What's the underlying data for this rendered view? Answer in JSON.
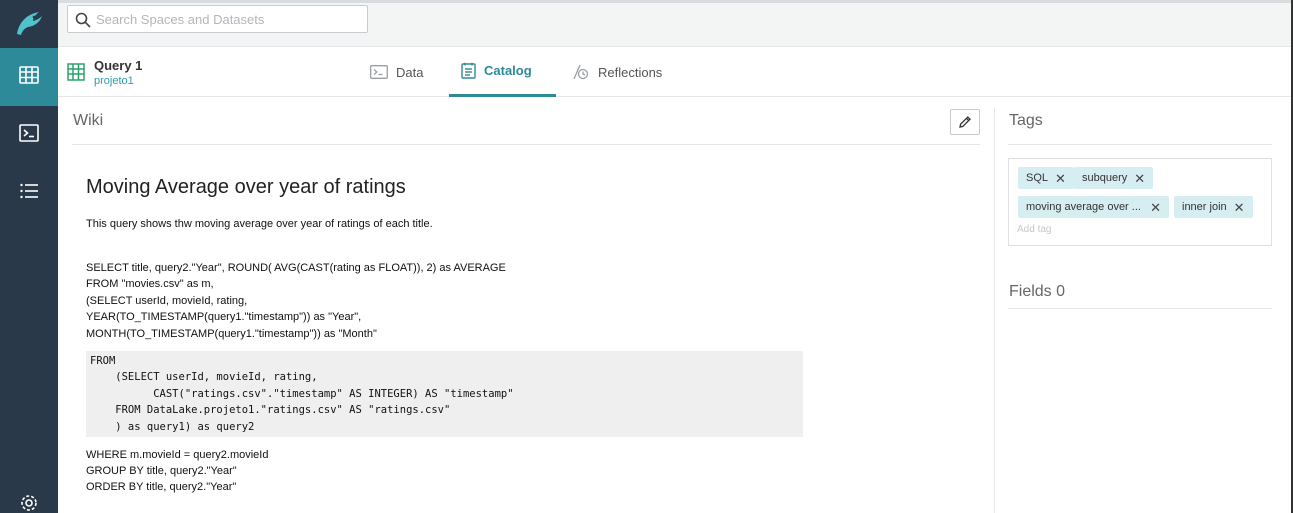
{
  "search": {
    "placeholder": "Search Spaces and Datasets"
  },
  "dataset": {
    "title": "Query 1",
    "space": "projeto1"
  },
  "tabs": [
    {
      "label": "Data",
      "icon": "terminal-icon"
    },
    {
      "label": "Catalog",
      "icon": "catalog-icon",
      "active": true
    },
    {
      "label": "Reflections",
      "icon": "reflections-icon"
    }
  ],
  "wiki": {
    "section_title": "Wiki",
    "heading": "Moving Average over year of ratings",
    "description": "This query shows thw moving average over year of ratings of each title.",
    "sql_lines": [
      "SELECT title, query2.\"Year\", ROUND( AVG(CAST(rating as FLOAT)), 2) as AVERAGE",
      "FROM \"movies.csv\" as m,",
      "(SELECT userId, movieId, rating,",
      "YEAR(TO_TIMESTAMP(query1.\"timestamp\")) as \"Year\",",
      "MONTH(TO_TIMESTAMP(query1.\"timestamp\")) as \"Month\""
    ],
    "code_block": "FROM\n    (SELECT userId, movieId, rating,\n          CAST(\"ratings.csv\".\"timestamp\" AS INTEGER) AS \"timestamp\"\n    FROM DataLake.projeto1.\"ratings.csv\" AS \"ratings.csv\"\n    ) as query1) as query2",
    "sql_after": [
      "WHERE m.movieId = query2.movieId",
      "GROUP BY title, query2.\"Year\"",
      "ORDER BY title, query2.\"Year\""
    ]
  },
  "tags": {
    "title": "Tags",
    "items": [
      "SQL",
      "subquery",
      "moving average over ...",
      "inner join"
    ],
    "add_placeholder": "Add tag"
  },
  "fields": {
    "title": "Fields 0"
  },
  "colors": {
    "nav": "#2a394a",
    "accent": "#2d8a99",
    "tag_bg": "#d6edf1"
  }
}
